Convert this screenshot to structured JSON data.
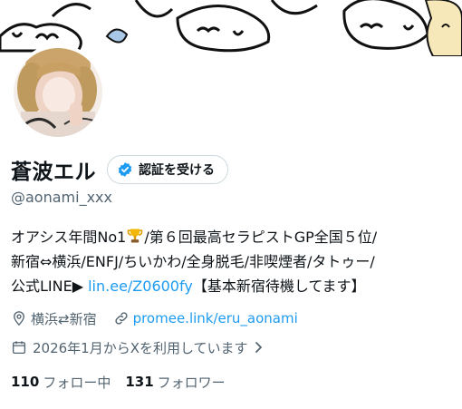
{
  "profile": {
    "display_name": "蒼波エル",
    "verify_label": "認証を受ける",
    "handle": "@aonami_xxx",
    "bio_line1_pre": "オアシス年間No1",
    "bio_line1_post": "/第６回最高セラピストGP全国５位/",
    "bio_line2": "新宿⇔横浜/ENFJ/ちいかわ/全身脱毛/非喫煙者/タトゥー/",
    "bio_line3_pre": "公式LINE▶ ",
    "bio_line3_link": "lin.ee/Z0600fy",
    "bio_line3_post": "【基本新宿待機してます】",
    "location": "横浜⇄新宿",
    "website": "promee.link/eru_aonami",
    "joined": "2026年1月からXを利用しています",
    "following_count": "110",
    "following_label": "フォロー中",
    "followers_count": "131",
    "followers_label": "フォロワー"
  },
  "icons": {
    "trophy": "trophy-icon",
    "verified": "verified-badge-icon",
    "location": "location-pin-icon",
    "link": "link-icon",
    "calendar": "calendar-icon",
    "chevron": "chevron-right-icon"
  },
  "colors": {
    "link": "#1d9bf0",
    "secondary_text": "#536471",
    "primary_text": "#0f1419",
    "border": "#cfd9de",
    "banner_yellow": "#f6e8b8",
    "banner_blue": "#a9c8e8"
  }
}
